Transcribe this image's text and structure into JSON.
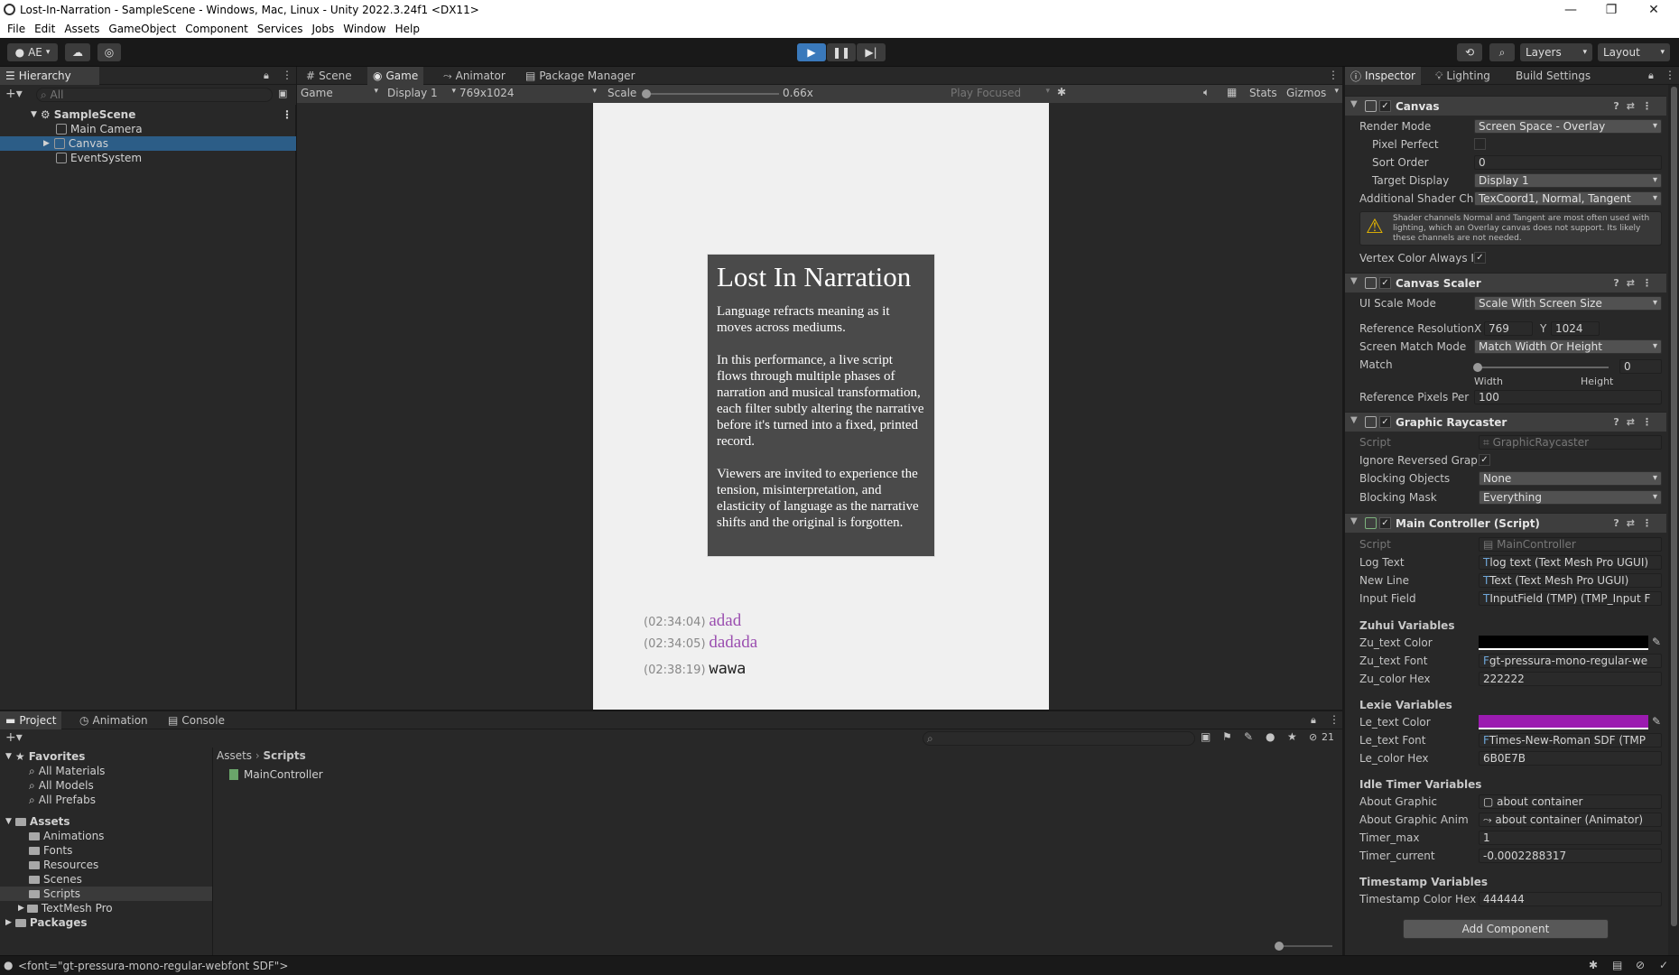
{
  "window": {
    "title": "Lost-In-Narration - SampleScene - Windows, Mac, Linux - Unity 2022.3.24f1 <DX11>"
  },
  "menu": [
    "File",
    "Edit",
    "Assets",
    "GameObject",
    "Component",
    "Services",
    "Jobs",
    "Window",
    "Help"
  ],
  "toolbar": {
    "account": "AE",
    "layers": "Layers",
    "layout": "Layout"
  },
  "hierarchy": {
    "tab": "Hierarchy",
    "search_placeholder": "All",
    "scene": "SampleScene",
    "items": [
      "Main Camera",
      "Canvas",
      "EventSystem"
    ],
    "selected": "Canvas"
  },
  "center_tabs": [
    "Scene",
    "Game",
    "Animator",
    "Package Manager"
  ],
  "game_bar": {
    "mode": "Game",
    "display": "Display 1",
    "resolution": "769x1024",
    "scale_label": "Scale",
    "scale_value": "0.66x",
    "play_focused": "Play Focused",
    "stats": "Stats",
    "gizmos": "Gizmos"
  },
  "game_view": {
    "card_title": "Lost In Narration",
    "p1": "Language refracts meaning as it moves across mediums.",
    "p2": "In this performance, a live script flows through multiple phases of narration and musical transformation, each filter subtly altering the narrative before it's turned into a fixed, printed record.",
    "p3": "Viewers are invited to experience the tension, misinterpretation, and elasticity of language as the narrative shifts and the original is forgotten.",
    "log": [
      {
        "time": "(02:34:04)",
        "text": "adad",
        "color": "#9B4FB0"
      },
      {
        "time": "(02:34:05)",
        "text": "dadada",
        "color": "#9B4FB0"
      },
      {
        "time": "(02:38:19)",
        "text": "wawa",
        "color": "#222222"
      }
    ]
  },
  "bottom_tabs": [
    "Project",
    "Animation",
    "Console"
  ],
  "project": {
    "favorites_label": "Favorites",
    "favorites": [
      "All Materials",
      "All Models",
      "All Prefabs"
    ],
    "assets_label": "Assets",
    "folders": [
      "Animations",
      "Fonts",
      "Resources",
      "Scenes",
      "Scripts",
      "TextMesh Pro"
    ],
    "packages_label": "Packages",
    "breadcrumb": [
      "Assets",
      "Scripts"
    ],
    "files": [
      "MainController"
    ],
    "hidden_count": "21"
  },
  "inspector_tabs": [
    "Inspector",
    "Lighting",
    "Build Settings"
  ],
  "canvas": {
    "name": "Canvas",
    "render_mode_label": "Render Mode",
    "render_mode": "Screen Space - Overlay",
    "pixel_perfect_label": "Pixel Perfect",
    "sort_order_label": "Sort Order",
    "sort_order": "0",
    "target_display_label": "Target Display",
    "target_display": "Display 1",
    "shader_label": "Additional Shader Ch",
    "shader": "TexCoord1, Normal, Tangent",
    "warning": "Shader channels Normal and Tangent are most often used with lighting, which an Overlay canvas does not support. Its likely these channels are not needed.",
    "vertex_label": "Vertex Color Always I"
  },
  "scaler": {
    "name": "Canvas Scaler",
    "ui_scale_label": "UI Scale Mode",
    "ui_scale": "Scale With Screen Size",
    "ref_res_label": "Reference Resolution",
    "x_label": "X",
    "x": "769",
    "y_label": "Y",
    "y": "1024",
    "match_mode_label": "Screen Match Mode",
    "match_mode": "Match Width Or Height",
    "match_label": "Match",
    "match": "0",
    "width_label": "Width",
    "height_label": "Height",
    "ref_ppu_label": "Reference Pixels Per",
    "ref_ppu": "100"
  },
  "raycaster": {
    "name": "Graphic Raycaster",
    "script_label": "Script",
    "script": "GraphicRaycaster",
    "ignore_label": "Ignore Reversed Grap",
    "blocking_obj_label": "Blocking Objects",
    "blocking_obj": "None",
    "blocking_mask_label": "Blocking Mask",
    "blocking_mask": "Everything"
  },
  "controller": {
    "name": "Main Controller (Script)",
    "script_label": "Script",
    "script": "MainController",
    "log_label": "Log Text",
    "log": "log text (Text Mesh Pro UGUI)",
    "newline_label": "New Line",
    "newline": "Text (Text Mesh Pro UGUI)",
    "input_label": "Input Field",
    "input": "InputField (TMP) (TMP_Input F",
    "zuhui_head": "Zuhui Variables",
    "zu_color_label": "Zu_text Color",
    "zu_color": "#FFFFFF",
    "zu_font_label": "Zu_text Font",
    "zu_font": "gt-pressura-mono-regular-we",
    "zu_hex_label": "Zu_color Hex",
    "zu_hex": "222222",
    "lexie_head": "Lexie Variables",
    "le_color_label": "Le_text Color",
    "le_color": "#6B0E7B",
    "le_font_label": "Le_text Font",
    "le_font": "Times-New-Roman SDF (TMP",
    "le_hex_label": "Le_color Hex",
    "le_hex": "6B0E7B",
    "idle_head": "Idle Timer Variables",
    "about_label": "About Graphic",
    "about": "about container",
    "about_anim_label": "About Graphic Anim",
    "about_anim": "about container (Animator)",
    "tmax_label": "Timer_max",
    "tmax": "1",
    "tcur_label": "Timer_current",
    "tcur": "-0.0002288317",
    "ts_head": "Timestamp Variables",
    "ts_hex_label": "Timestamp Color Hex",
    "ts_hex": "444444"
  },
  "add_component": "Add Component",
  "status": "<font=\"gt-pressura-mono-regular-webfont SDF\">"
}
